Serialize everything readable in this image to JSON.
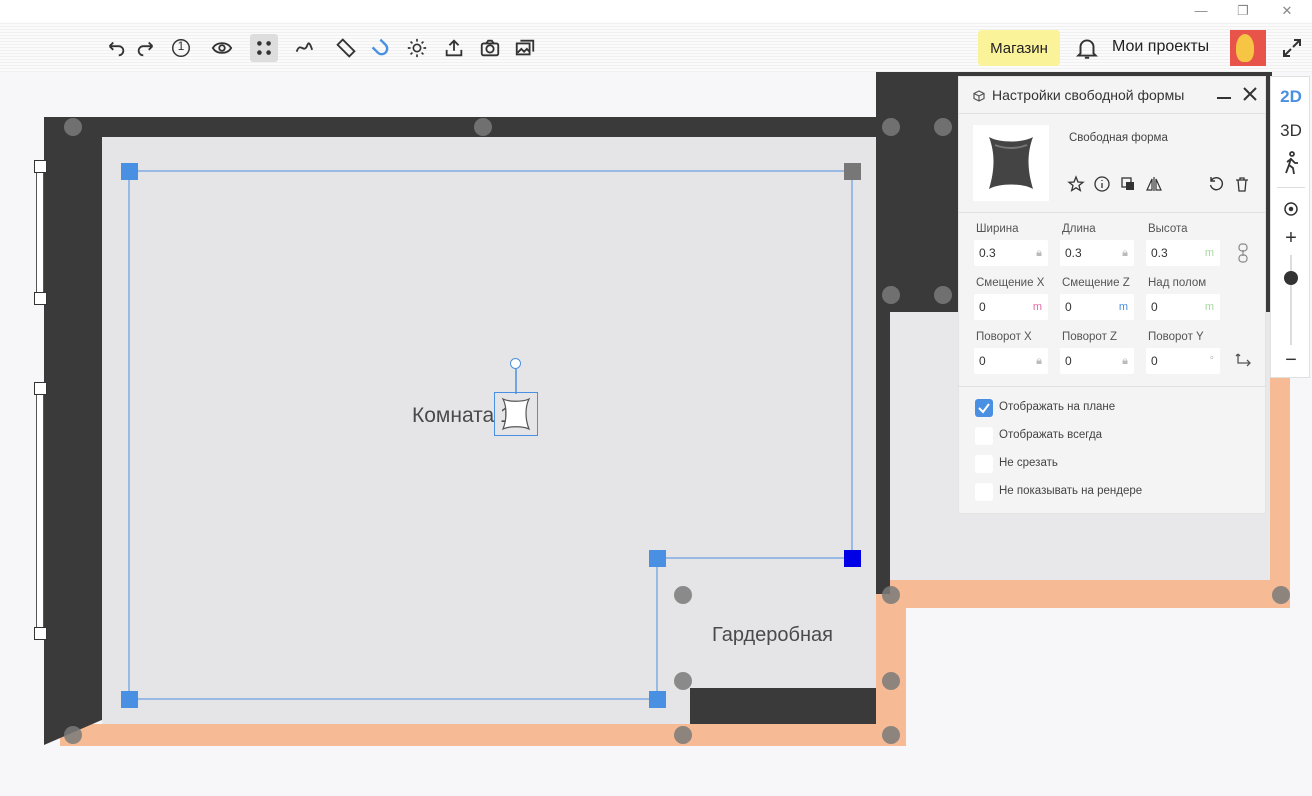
{
  "window": {
    "minimize": "—",
    "restore": "❐",
    "close": "✕"
  },
  "toolbar": {
    "icons": [
      "undo-icon",
      "redo-icon",
      "level-icon",
      "eye-icon",
      "snap-grid-icon",
      "path-icon",
      "ruler-icon",
      "magnet-icon",
      "sun-icon",
      "upload-icon",
      "camera-icon",
      "gallery-icon"
    ],
    "level_number": "1",
    "shop_label": "Магазин",
    "my_projects_label": "Мои проекты",
    "accent": "#4a90e2"
  },
  "plan": {
    "room1_label": "Комната 1",
    "wardrobe_label": "Гардеробная",
    "colors": {
      "wall": "#3a3a3a",
      "floor": "#e5e5e7",
      "outline": "#f6bb94",
      "selection": "#4a90e2"
    }
  },
  "panel": {
    "title": "Настройки свободной формы",
    "item_name": "Свободная форма",
    "fields": [
      {
        "label": "Ширина",
        "value": "0.3",
        "suffix": "lock"
      },
      {
        "label": "Длина",
        "value": "0.3",
        "suffix": "lock"
      },
      {
        "label": "Высота",
        "value": "0.3",
        "suffix": "m"
      },
      {
        "label": "Смещение X",
        "value": "0",
        "suffix": "m"
      },
      {
        "label": "Смещение Z",
        "value": "0",
        "suffix": "m"
      },
      {
        "label": "Над полом",
        "value": "0",
        "suffix": "m"
      },
      {
        "label": "Поворот X",
        "value": "0",
        "suffix": "lock"
      },
      {
        "label": "Поворот Z",
        "value": "0",
        "suffix": "lock"
      },
      {
        "label": "Поворот Y",
        "value": "0",
        "suffix": "°"
      }
    ],
    "checkboxes": [
      {
        "label": "Отображать на плане",
        "checked": true
      },
      {
        "label": "Отображать всегда",
        "checked": false
      },
      {
        "label": "Не срезать",
        "checked": false
      },
      {
        "label": "Не показывать на рендере",
        "checked": false
      }
    ]
  },
  "viewbar": {
    "mode_2d": "2D",
    "mode_3d": "3D",
    "zoom_in": "+",
    "zoom_out": "−",
    "zoom_level": 0.75
  }
}
